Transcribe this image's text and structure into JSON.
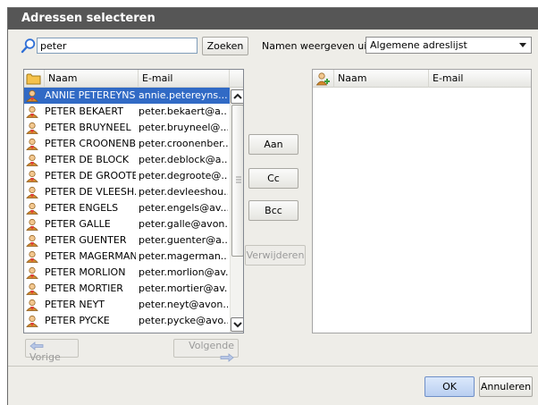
{
  "dialog": {
    "title": "Adressen selecteren"
  },
  "search": {
    "value": "peter",
    "button_label": "Zoeken"
  },
  "source": {
    "label": "Namen weergeven uit:",
    "selected": "Algemene adreslijst"
  },
  "left_list": {
    "columns": {
      "name": "Naam",
      "email": "E-mail"
    },
    "rows": [
      {
        "name": "ANNIE PETEREYNS",
        "email": "annie.petereyns..."
      },
      {
        "name": "PETER BEKAERT",
        "email": "peter.bekaert@a..."
      },
      {
        "name": "PETER BRUYNEEL",
        "email": "peter.bruyneel@..."
      },
      {
        "name": "PETER CROONENB...",
        "email": "peter.croonenber..."
      },
      {
        "name": "PETER DE BLOCK",
        "email": "peter.deblock@a..."
      },
      {
        "name": "PETER DE GROOTE",
        "email": "peter.degroote@..."
      },
      {
        "name": "PETER DE VLEESH...",
        "email": "peter.devleeshou..."
      },
      {
        "name": "PETER ENGELS",
        "email": "peter.engels@av..."
      },
      {
        "name": "PETER GALLE",
        "email": "peter.galle@avon..."
      },
      {
        "name": "PETER GUENTER",
        "email": "peter.guenter@a..."
      },
      {
        "name": "PETER MAGERMAN",
        "email": "peter.magerman..."
      },
      {
        "name": "PETER MORLION",
        "email": "peter.morlion@av..."
      },
      {
        "name": "PETER MORTIER",
        "email": "peter.mortier@av..."
      },
      {
        "name": "PETER NEYT",
        "email": "peter.neyt@avon..."
      },
      {
        "name": "PETER PYCKE",
        "email": "peter.pycke@avo..."
      }
    ]
  },
  "right_list": {
    "columns": {
      "name": "Naam",
      "email": "E-mail"
    }
  },
  "transfer": {
    "to": "Aan",
    "cc": "Cc",
    "bcc": "Bcc",
    "remove": "Verwijderen"
  },
  "pager": {
    "prev": "Vorige",
    "next": "Volgende"
  },
  "actions": {
    "ok": "OK",
    "cancel": "Annuleren"
  },
  "colors": {
    "selection": "#316ac5",
    "titlebar": "#565656",
    "dialog_bg": "#eeede8"
  }
}
